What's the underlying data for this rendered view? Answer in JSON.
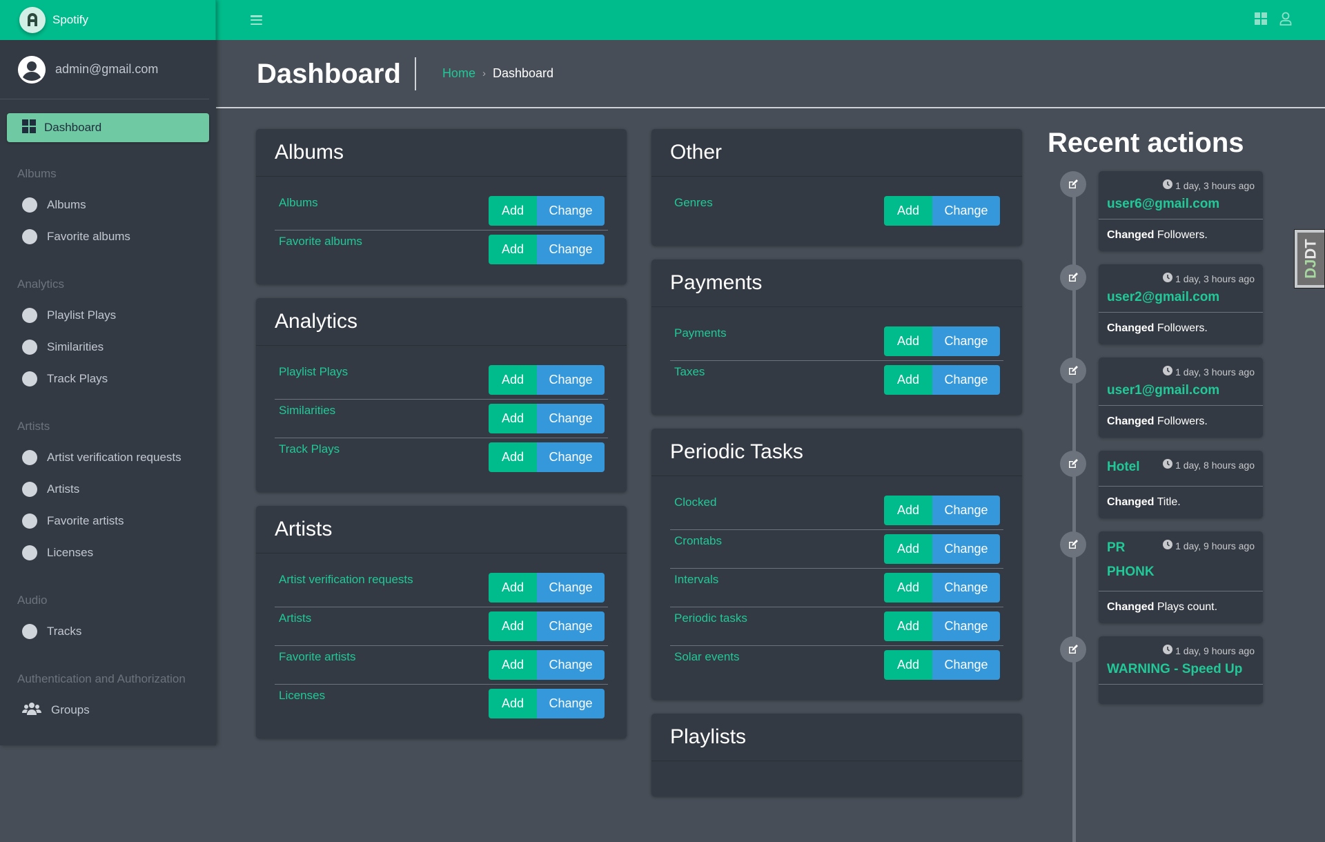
{
  "brand": {
    "name": "Spotify",
    "logo_letter": "A"
  },
  "user": {
    "email": "admin@gmail.com"
  },
  "sidebar": {
    "active": {
      "label": "Dashboard",
      "icon": "dashboard-icon"
    },
    "sections": [
      {
        "header": "Albums",
        "items": [
          {
            "label": "Albums",
            "icon": "circle-icon"
          },
          {
            "label": "Favorite albums",
            "icon": "circle-icon"
          }
        ]
      },
      {
        "header": "Analytics",
        "items": [
          {
            "label": "Playlist Plays",
            "icon": "circle-icon"
          },
          {
            "label": "Similarities",
            "icon": "circle-icon"
          },
          {
            "label": "Track Plays",
            "icon": "circle-icon"
          }
        ]
      },
      {
        "header": "Artists",
        "items": [
          {
            "label": "Artist verification requests",
            "icon": "circle-icon"
          },
          {
            "label": "Artists",
            "icon": "circle-icon"
          },
          {
            "label": "Favorite artists",
            "icon": "circle-icon"
          },
          {
            "label": "Licenses",
            "icon": "circle-icon"
          }
        ]
      },
      {
        "header": "Audio",
        "items": [
          {
            "label": "Tracks",
            "icon": "circle-icon"
          }
        ]
      },
      {
        "header": "Authentication and Authorization",
        "items": [
          {
            "label": "Groups",
            "icon": "users-icon"
          }
        ]
      }
    ]
  },
  "topbar": {
    "menu_icon": "hamburger-icon",
    "right_icons": [
      "grid-icon",
      "user-icon"
    ]
  },
  "header": {
    "title": "Dashboard",
    "breadcrumb": {
      "home": "Home",
      "separator": "›",
      "current": "Dashboard"
    }
  },
  "buttons": {
    "add": "Add",
    "change": "Change"
  },
  "cards": {
    "col1": [
      {
        "title": "Albums",
        "rows": [
          "Albums",
          "Favorite albums"
        ]
      },
      {
        "title": "Analytics",
        "rows": [
          "Playlist Plays",
          "Similarities",
          "Track Plays"
        ]
      },
      {
        "title": "Artists",
        "rows": [
          "Artist verification requests",
          "Artists",
          "Favorite artists",
          "Licenses"
        ]
      }
    ],
    "col2": [
      {
        "title": "Other",
        "rows": [
          "Genres"
        ]
      },
      {
        "title": "Payments",
        "rows": [
          "Payments",
          "Taxes"
        ]
      },
      {
        "title": "Periodic Tasks",
        "rows": [
          "Clocked",
          "Crontabs",
          "Intervals",
          "Periodic tasks",
          "Solar events"
        ]
      },
      {
        "title": "Playlists",
        "rows": []
      }
    ]
  },
  "recent": {
    "title": "Recent actions",
    "items": [
      {
        "time": "1 day, 3 hours ago",
        "object": "user6@gmail.com",
        "action": "Changed",
        "detail": "Followers.",
        "inline": false
      },
      {
        "time": "1 day, 3 hours ago",
        "object": "user2@gmail.com",
        "action": "Changed",
        "detail": "Followers.",
        "inline": false
      },
      {
        "time": "1 day, 3 hours ago",
        "object": "user1@gmail.com",
        "action": "Changed",
        "detail": "Followers.",
        "inline": false
      },
      {
        "time": "1 day, 8 hours ago",
        "object": "Hotel",
        "action": "Changed",
        "detail": "Title.",
        "inline": true
      },
      {
        "time": "1 day, 9 hours ago",
        "object": "PR PHONK",
        "action": "Changed",
        "detail": "Plays count.",
        "inline": true
      },
      {
        "time": "1 day, 9 hours ago",
        "object": "WARNING - Speed Up",
        "action": "",
        "detail": "",
        "inline": false
      }
    ]
  },
  "debug_toolbar": {
    "label_a": "DJ",
    "label_b": "DT"
  },
  "colors": {
    "accent": "#00bc8c",
    "link": "#20c997",
    "change": "#3498db",
    "sidebar_bg": "#343a43",
    "content_bg": "#474e57"
  }
}
